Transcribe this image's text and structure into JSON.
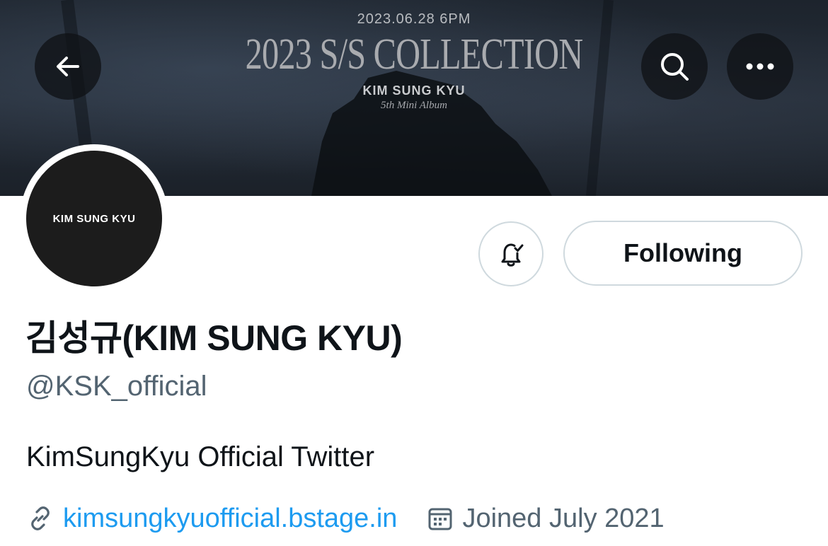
{
  "banner": {
    "date": "2023.06.28 6PM",
    "title": "2023 S/S COLLECTION",
    "artist": "KIM SUNG KYU",
    "subtitle": "5th Mini Album"
  },
  "nav": {
    "back_icon": "arrow-left-icon",
    "search_icon": "search-icon",
    "more_icon": "more-horizontal-icon"
  },
  "avatar": {
    "text": "KIM SUNG KYU"
  },
  "actions": {
    "notification_icon": "bell-check-icon",
    "follow_label": "Following"
  },
  "profile": {
    "display_name": "김성규(KIM SUNG KYU)",
    "handle": "@KSK_official",
    "bio": "KimSungKyu Official Twitter",
    "website": "kimsungkyuofficial.bstage.in",
    "joined": "Joined July 2021"
  },
  "colors": {
    "link": "#1d9bf0",
    "secondary_text": "#536471",
    "primary_text": "#0f1419",
    "border": "#cfd9de"
  }
}
